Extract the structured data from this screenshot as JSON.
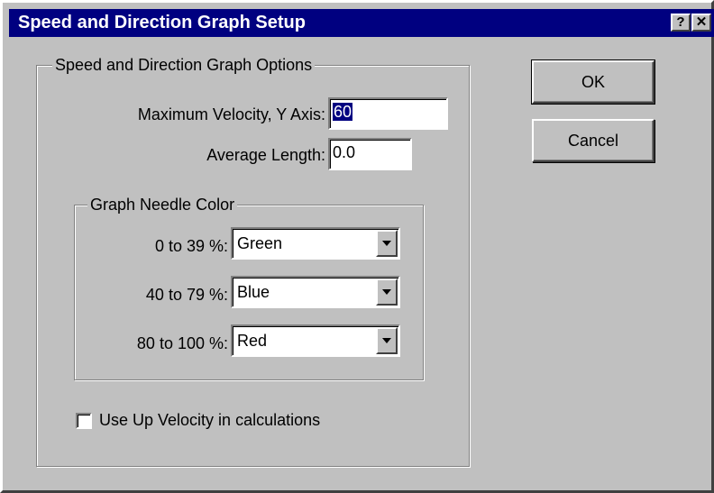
{
  "window": {
    "title": "Speed and Direction Graph Setup",
    "help_button": "?",
    "close_button": "✕"
  },
  "options_group": {
    "legend": "Speed and Direction Graph Options",
    "max_velocity": {
      "label": "Maximum Velocity, Y Axis:",
      "value": "60"
    },
    "average_length": {
      "label": "Average Length:",
      "value": "0.0"
    }
  },
  "needle_color_group": {
    "legend": "Graph Needle Color",
    "rows": [
      {
        "label": "0 to 39 %:",
        "value": "Green"
      },
      {
        "label": "40 to 79 %:",
        "value": "Blue"
      },
      {
        "label": "80 to 100 %:",
        "value": "Red"
      }
    ]
  },
  "use_up_velocity": {
    "label": "Use Up Velocity in calculations",
    "checked": false
  },
  "buttons": {
    "ok": "OK",
    "cancel": "Cancel"
  }
}
